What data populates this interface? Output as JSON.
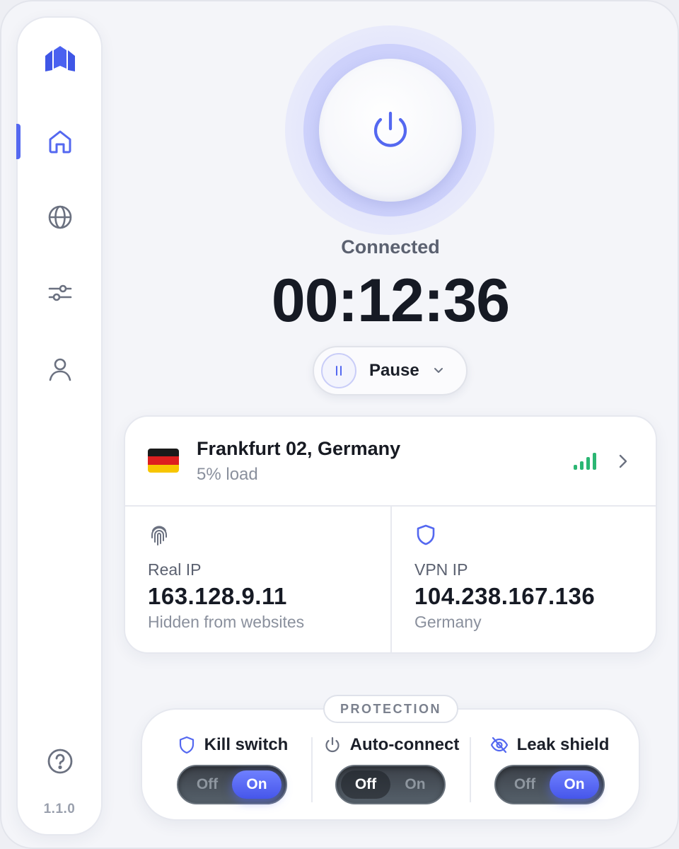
{
  "app": {
    "version": "1.1.0"
  },
  "sidebar": {
    "items": [
      {
        "id": "home",
        "icon": "home-icon",
        "active": true
      },
      {
        "id": "servers",
        "icon": "globe-icon",
        "active": false
      },
      {
        "id": "settings",
        "icon": "sliders-icon",
        "active": false
      },
      {
        "id": "account",
        "icon": "user-icon",
        "active": false
      }
    ],
    "help_icon": "help-circle-icon"
  },
  "connection": {
    "status": "Connected",
    "timer": "00:12:36",
    "pause_label": "Pause"
  },
  "server": {
    "name": "Frankfurt 02, Germany",
    "load": "5% load",
    "flag_colors": [
      "#1a1a1a",
      "#dd1f1f",
      "#f7c600"
    ],
    "signal_color": "#2bb673"
  },
  "ip": {
    "real": {
      "title": "Real IP",
      "value": "163.128.9.11",
      "note": "Hidden from websites"
    },
    "vpn": {
      "title": "VPN IP",
      "value": "104.238.167.136",
      "note": "Germany"
    }
  },
  "protection": {
    "label": "PROTECTION",
    "features": [
      {
        "name": "Kill switch",
        "icon": "shield-icon",
        "state": "On"
      },
      {
        "name": "Auto-connect",
        "icon": "power-icon",
        "state": "Off"
      },
      {
        "name": "Leak shield",
        "icon": "eye-off-icon",
        "state": "On"
      }
    ],
    "off_label": "Off",
    "on_label": "On"
  },
  "colors": {
    "accent": "#5468f0",
    "background": "#f4f5f9",
    "toggle_track": "#3c4149"
  }
}
